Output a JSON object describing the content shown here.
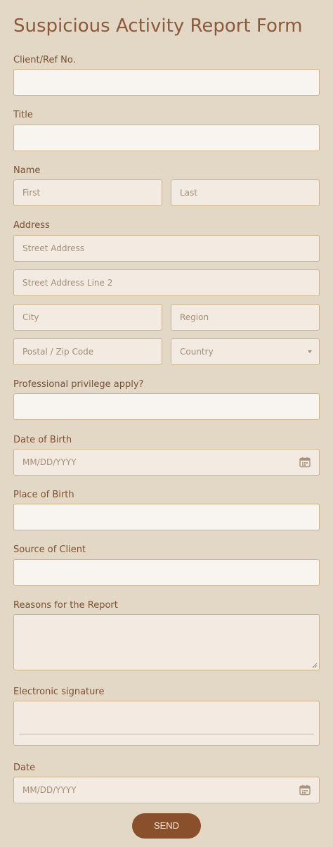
{
  "form": {
    "title": "Suspicious Activity Report Form",
    "fields": {
      "client_ref": {
        "label": "Client/Ref No."
      },
      "title": {
        "label": "Title"
      },
      "name": {
        "label": "Name",
        "first_placeholder": "First",
        "last_placeholder": "Last"
      },
      "address": {
        "label": "Address",
        "street_placeholder": "Street Address",
        "street2_placeholder": "Street Address Line 2",
        "city_placeholder": "City",
        "region_placeholder": "Region",
        "postal_placeholder": "Postal / Zip Code",
        "country_placeholder": "Country"
      },
      "privilege": {
        "label": "Professional privilege apply?"
      },
      "dob": {
        "label": "Date of Birth",
        "placeholder": "MM/DD/YYYY",
        "icon": "calendar-icon"
      },
      "pob": {
        "label": "Place of Birth"
      },
      "source": {
        "label": "Source of Client"
      },
      "reasons": {
        "label": "Reasons for the Report"
      },
      "signature": {
        "label": "Electronic signature"
      },
      "date": {
        "label": "Date",
        "placeholder": "MM/DD/YYYY",
        "icon": "calendar-icon"
      }
    },
    "send_label": "SEND"
  },
  "colors": {
    "background": "#e3d8c6",
    "title": "#8b5a3a",
    "label": "#7a4f32",
    "border": "#c9b38d",
    "button": "#8a4f2b"
  }
}
